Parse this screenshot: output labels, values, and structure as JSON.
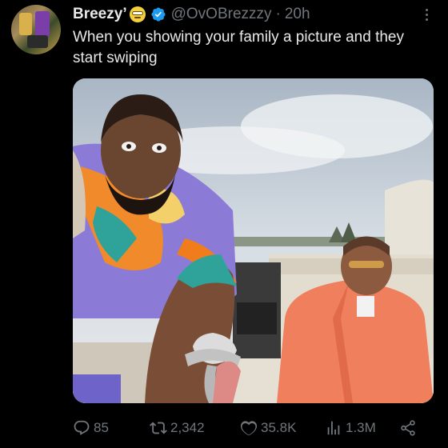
{
  "tweet": {
    "display_name": "Breezy’",
    "handle": "@OvOBrezzzy",
    "separator": "·",
    "time": "20h",
    "text": "When you showing your family a picture and they start swiping"
  },
  "actions": {
    "replies": "85",
    "retweets": "2,342",
    "likes": "35.8K",
    "views": "1.3M"
  },
  "icons": {
    "verified": "verified-badge-icon",
    "emoji": "sunglasses-emoji-icon",
    "more": "more-vertical-icon",
    "reply": "reply-icon",
    "retweet": "retweet-icon",
    "like": "heart-icon",
    "views": "views-icon",
    "share": "share-icon"
  },
  "colors": {
    "background": "#000000",
    "text": "#e7e9ea",
    "muted": "#71767b",
    "verified": "#1d9bf0"
  }
}
